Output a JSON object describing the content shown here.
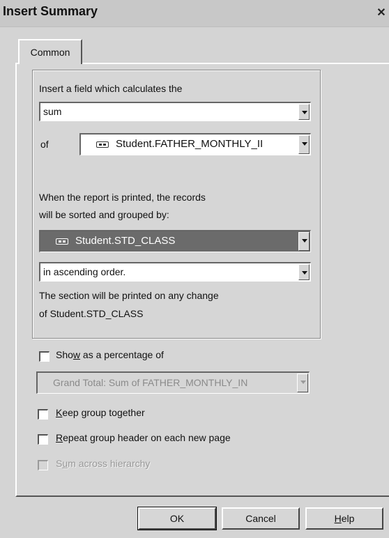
{
  "window": {
    "title": "Insert Summary",
    "close_glyph": "✕"
  },
  "tabs": [
    {
      "label": "Common"
    }
  ],
  "group": {
    "calc_label": "Insert a field which calculates the",
    "function_value": "sum",
    "of_label": "of",
    "field_value": "Student.FATHER_MONTHLY_II",
    "sort_line1": "When the report is printed, the records",
    "sort_line2": "will be sorted and grouped by:",
    "group_field_value": "Student.STD_CLASS",
    "order_value": "in ascending order.",
    "section_line1": "The section will be printed on any change",
    "section_line2": "of  Student.STD_CLASS"
  },
  "options": {
    "show_percentage": {
      "label_pre": "Sho",
      "label_key": "w",
      "label_post": " as a percentage of",
      "checked": false
    },
    "percentage_value": "Grand Total: Sum of FATHER_MONTHLY_IN",
    "keep_group": {
      "label_key": "K",
      "label_post": "eep group together",
      "checked": false
    },
    "repeat_header": {
      "label_key": "R",
      "label_post": "epeat group header on each new page",
      "checked": false
    },
    "sum_hierarchy": {
      "label_pre": "S",
      "label_key": "u",
      "label_post": "m across hierarchy",
      "checked": false,
      "disabled": true
    }
  },
  "buttons": {
    "ok": "OK",
    "cancel": "Cancel",
    "help_key": "H",
    "help_post": "elp"
  }
}
